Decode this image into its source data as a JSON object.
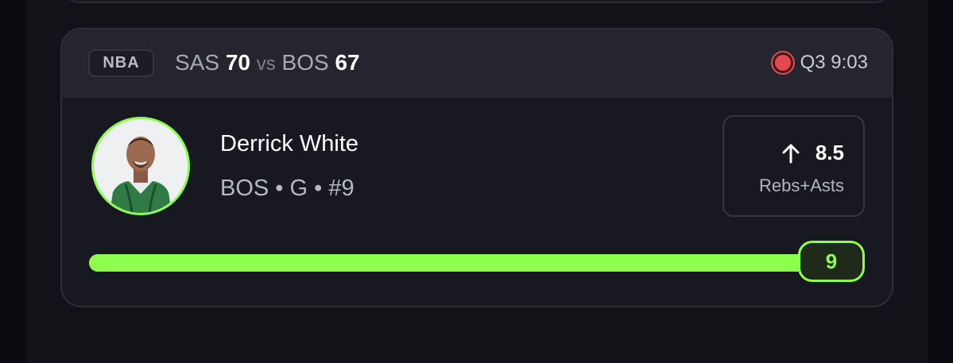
{
  "card": {
    "league": "NBA",
    "matchup": {
      "away_team": "SAS",
      "away_score": "70",
      "separator": "vs",
      "home_team": "BOS",
      "home_score": "67"
    },
    "game_status": "Q3 9:03"
  },
  "player": {
    "name": "Derrick White",
    "meta": "BOS • G • #9"
  },
  "prop": {
    "direction_icon": "arrow-up-icon",
    "line": "8.5",
    "stat": "Rebs+Asts"
  },
  "progress": {
    "current_value": "9",
    "fraction": 1.0
  },
  "colors": {
    "accent": "#8dfd4e",
    "live": "#e5484d",
    "card_bg": "#171820",
    "header_bg": "#24252e"
  }
}
